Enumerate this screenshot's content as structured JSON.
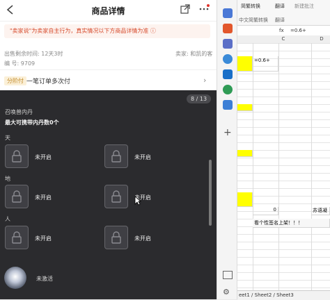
{
  "phone": {
    "back_icon": "chevron-left-icon",
    "title": "商品详情",
    "share_icon": "share-icon",
    "more_icon": "more-dots-icon",
    "notice": "\"卖家说\"为卖家自主行为，真实情况以下方商品详情为准 ⓘ",
    "meta_left_1": "出售剩余时间: 12天3时",
    "meta_right_1": "卖家: 和凯的客",
    "meta_left_2": "编 号: 9709",
    "gold_tag": "分阶付",
    "gold_text": "一笔订单多次付",
    "gold_chevron": "›",
    "counter": "8 / 13",
    "summon_title": "召唤兽内丹",
    "summon_desc": "最大可携带内丹数0个",
    "section_tian": "天",
    "section_di": "地",
    "section_ren": "人",
    "slot_status": "未开启",
    "bottom_status": "未激活"
  },
  "excel": {
    "ribbon_btn_1": "简繁转换",
    "ribbon_btn_2": "翻译",
    "ribbon_btn_3": "新建批注",
    "ribbon_group": "中文简繁转换",
    "ribbon_group_2": "翻译",
    "formula_prefix": "fx",
    "formula_value": "=0.6+",
    "col_c": "C",
    "col_d": "D",
    "cell_formula": "=0.6+",
    "cell_zero": "0",
    "cell_su": "苏语凝",
    "cell_note": "看个性签名上架！！！",
    "sheet_tabs": "eet1 / Sheet2 / Sheet3"
  }
}
